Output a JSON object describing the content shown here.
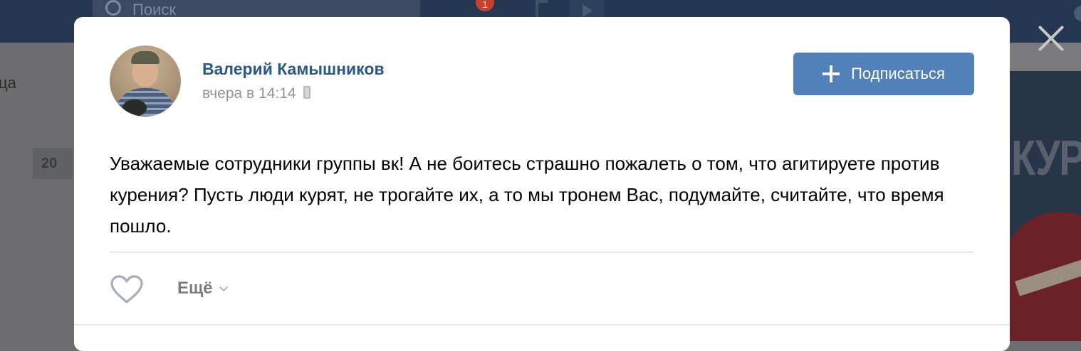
{
  "background": {
    "search_placeholder": "Поиск",
    "notification_count": "1",
    "left_text": "ца",
    "left_number": "20",
    "right_banner_text": "КУРИ"
  },
  "post": {
    "author_name": "Валерий Камышников",
    "timestamp": "вчера в 14:14",
    "timestamp_icon": "mobile-icon",
    "subscribe_label": "Подписаться",
    "text": "Уважаемые сотрудники группы вк! А не боитесь страшно пожалеть о том, что агитируете против курения? Пусть люди курят, не трогайте их, а то мы тронем Вас, подумайте, считайте, что время пошло.",
    "more_label": "Ещё"
  },
  "colors": {
    "accent": "#5181b8",
    "author_link": "#2a5885",
    "header_bg": "#243650"
  }
}
